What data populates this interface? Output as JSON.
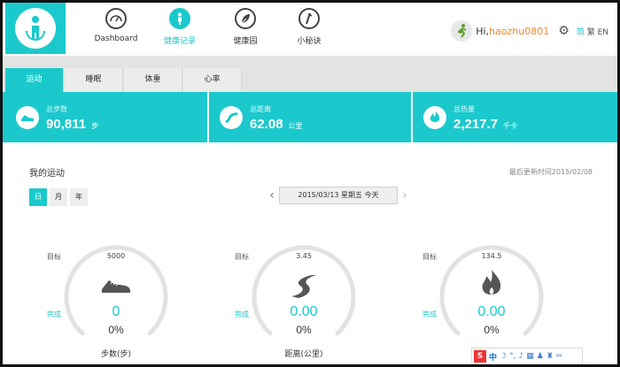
{
  "nav": {
    "items": [
      {
        "label": "Dashboard",
        "icon": "speedometer-icon",
        "glyph": "⌚"
      },
      {
        "label": "健康记录",
        "icon": "person-icon",
        "glyph": "⚲"
      },
      {
        "label": "健康园",
        "icon": "leaf-icon",
        "glyph": "❦"
      },
      {
        "label": "小秘诀",
        "icon": "tip-icon",
        "glyph": "✎"
      }
    ],
    "active_index": 1
  },
  "user": {
    "greeting": "Hi,",
    "username": "haozhu0801",
    "lang_simplified": "简",
    "lang_traditional": "繁",
    "lang_english": "EN"
  },
  "tabs": [
    {
      "label": "运动"
    },
    {
      "label": "睡眠"
    },
    {
      "label": "体重"
    },
    {
      "label": "心率"
    }
  ],
  "stats": [
    {
      "label": "总步数",
      "value": "90,811",
      "unit": "步",
      "icon": "shoe-icon"
    },
    {
      "label": "总距离",
      "value": "62.08",
      "unit": "公里",
      "icon": "road-icon"
    },
    {
      "label": "总热量",
      "value": "2,217.7",
      "unit": "千卡",
      "icon": "flame-icon"
    }
  ],
  "main": {
    "title": "我的运动",
    "updated": "最后更新时间2015/02/08",
    "periods": [
      "日",
      "月",
      "年"
    ],
    "active_period": 0,
    "date": "2015/03/13 星期五 今天"
  },
  "gauges": [
    {
      "target_label": "目标",
      "target": "5000",
      "done_label": "完成",
      "done": "0",
      "percent": "0%",
      "name": "步数(步)",
      "icon": "shoe-icon",
      "fraction": 0
    },
    {
      "target_label": "目标",
      "target": "3.45",
      "done_label": "完成",
      "done": "0.00",
      "percent": "0%",
      "name": "距离(公里)",
      "icon": "road-icon",
      "fraction": 0
    },
    {
      "target_label": "目标",
      "target": "134.5",
      "done_label": "完成",
      "done": "0.00",
      "percent": "0%",
      "name": "",
      "icon": "flame-icon",
      "fraction": 0
    }
  ],
  "ime": {
    "logo": "S",
    "mode": "中"
  },
  "colors": {
    "accent": "#1bc9cc",
    "username": "#f08a2c"
  }
}
